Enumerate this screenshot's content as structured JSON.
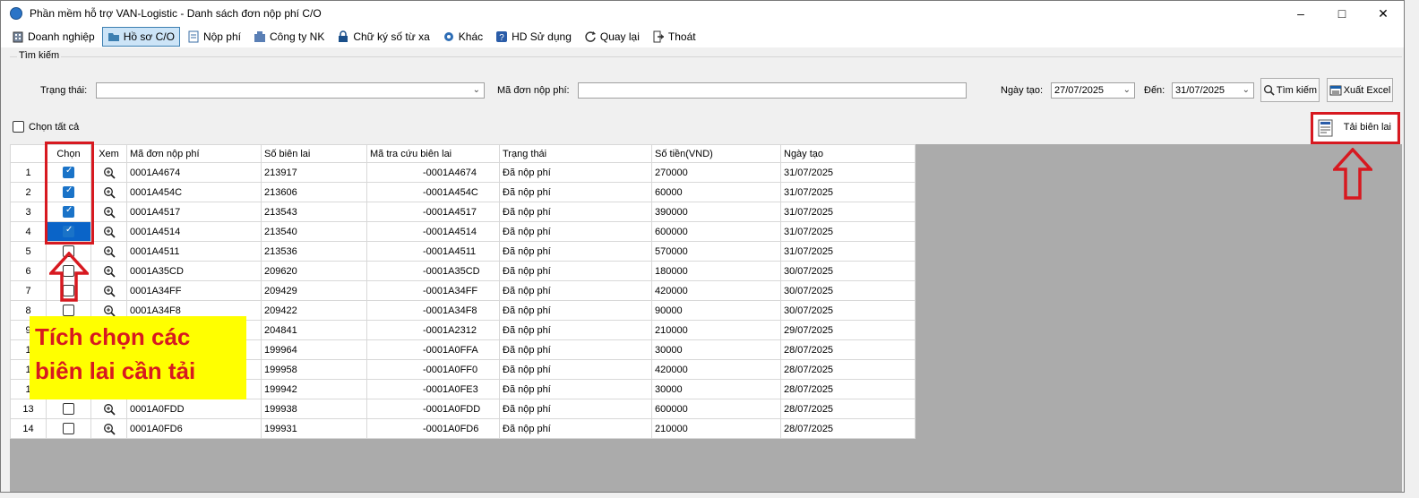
{
  "window": {
    "title": "Phần mềm hỗ trợ VAN-Logistic - Danh sách đơn nộp phí C/O",
    "minimize": "–",
    "maximize": "□",
    "close": "✕"
  },
  "menu": [
    {
      "label": "Doanh nghiệp",
      "icon": "building-icon",
      "active": false
    },
    {
      "label": "Hồ sơ C/O",
      "icon": "folder-icon",
      "active": true
    },
    {
      "label": "Nộp phí",
      "icon": "document-icon",
      "active": false
    },
    {
      "label": "Công ty NK",
      "icon": "company-icon",
      "active": false
    },
    {
      "label": "Chữ ký số từ xa",
      "icon": "lock-icon",
      "active": false
    },
    {
      "label": "Khác",
      "icon": "gear-icon",
      "active": false
    },
    {
      "label": "HD Sử dụng",
      "icon": "help-icon",
      "active": false
    },
    {
      "label": "Quay lại",
      "icon": "refresh-icon",
      "active": false
    },
    {
      "label": "Thoát",
      "icon": "exit-icon",
      "active": false
    }
  ],
  "search": {
    "legend": "Tìm kiếm",
    "status_label": "Trạng thái:",
    "status_value": "",
    "code_label": "Mã đơn nộp phí:",
    "code_value": "",
    "date_from_label": "Ngày tạo:",
    "date_from": "27/07/2025",
    "date_to_label": "Đến:",
    "date_to": "31/07/2025",
    "search_button": "Tìm kiếm",
    "export_button": "Xuất Excel"
  },
  "select_all_label": "Chọn tất cả",
  "download_button": "Tải biên lai",
  "grid": {
    "columns": [
      "",
      "Chọn",
      "Xem",
      "Mã đơn nộp phí",
      "Số biên lai",
      "Mã tra cứu biên lai",
      "Trạng thái",
      "Số tiền(VND)",
      "Ngày tạo"
    ],
    "rows": [
      {
        "no": "1",
        "checked": true,
        "selected": false,
        "code": "0001A4674",
        "receipt": "213917",
        "lookup": "-0001A4674",
        "status": "Đã nộp phí",
        "amount": "270000",
        "date": "31/07/2025"
      },
      {
        "no": "2",
        "checked": true,
        "selected": false,
        "code": "0001A454C",
        "receipt": "213606",
        "lookup": "-0001A454C",
        "status": "Đã nộp phí",
        "amount": "60000",
        "date": "31/07/2025"
      },
      {
        "no": "3",
        "checked": true,
        "selected": false,
        "code": "0001A4517",
        "receipt": "213543",
        "lookup": "-0001A4517",
        "status": "Đã nộp phí",
        "amount": "390000",
        "date": "31/07/2025"
      },
      {
        "no": "4",
        "checked": true,
        "selected": true,
        "code": "0001A4514",
        "receipt": "213540",
        "lookup": "-0001A4514",
        "status": "Đã nộp phí",
        "amount": "600000",
        "date": "31/07/2025"
      },
      {
        "no": "5",
        "checked": false,
        "selected": false,
        "code": "0001A4511",
        "receipt": "213536",
        "lookup": "-0001A4511",
        "status": "Đã nộp phí",
        "amount": "570000",
        "date": "31/07/2025"
      },
      {
        "no": "6",
        "checked": false,
        "selected": false,
        "code": "0001A35CD",
        "receipt": "209620",
        "lookup": "-0001A35CD",
        "status": "Đã nộp phí",
        "amount": "180000",
        "date": "30/07/2025"
      },
      {
        "no": "7",
        "checked": false,
        "selected": false,
        "code": "0001A34FF",
        "receipt": "209429",
        "lookup": "-0001A34FF",
        "status": "Đã nộp phí",
        "amount": "420000",
        "date": "30/07/2025"
      },
      {
        "no": "8",
        "checked": false,
        "selected": false,
        "code": "0001A34F8",
        "receipt": "209422",
        "lookup": "-0001A34F8",
        "status": "Đã nộp phí",
        "amount": "90000",
        "date": "30/07/2025"
      },
      {
        "no": "9",
        "checked": false,
        "selected": false,
        "code": "",
        "receipt": "204841",
        "lookup": "-0001A2312",
        "status": "Đã nộp phí",
        "amount": "210000",
        "date": "29/07/2025"
      },
      {
        "no": "1",
        "checked": false,
        "selected": false,
        "code": "",
        "receipt": "199964",
        "lookup": "-0001A0FFA",
        "status": "Đã nộp phí",
        "amount": "30000",
        "date": "28/07/2025"
      },
      {
        "no": "1",
        "checked": false,
        "selected": false,
        "code": "",
        "receipt": "199958",
        "lookup": "-0001A0FF0",
        "status": "Đã nộp phí",
        "amount": "420000",
        "date": "28/07/2025"
      },
      {
        "no": "1",
        "checked": false,
        "selected": false,
        "code": "",
        "receipt": "199942",
        "lookup": "-0001A0FE3",
        "status": "Đã nộp phí",
        "amount": "30000",
        "date": "28/07/2025"
      },
      {
        "no": "13",
        "checked": false,
        "selected": false,
        "code": "0001A0FDD",
        "receipt": "199938",
        "lookup": "-0001A0FDD",
        "status": "Đã nộp phí",
        "amount": "600000",
        "date": "28/07/2025"
      },
      {
        "no": "14",
        "checked": false,
        "selected": false,
        "code": "0001A0FD6",
        "receipt": "199931",
        "lookup": "-0001A0FD6",
        "status": "Đã nộp phí",
        "amount": "210000",
        "date": "28/07/2025"
      }
    ]
  },
  "callout": {
    "line1": "Tích chọn các",
    "line2": "biên lai cần tải"
  },
  "colors": {
    "annotation_red": "#d71920",
    "callout_yellow": "#ffff00",
    "check_blue": "#1a73c8"
  }
}
